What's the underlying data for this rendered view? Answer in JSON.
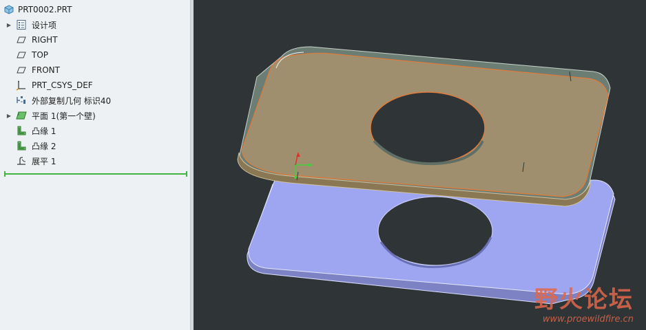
{
  "model_tree": {
    "root": {
      "label": "PRT0002.PRT",
      "icon": "part-icon"
    },
    "items": [
      {
        "label": "设计项",
        "icon": "layer-list-icon",
        "expandable": true
      },
      {
        "label": "RIGHT",
        "icon": "datum-plane-icon",
        "expandable": false
      },
      {
        "label": "TOP",
        "icon": "datum-plane-icon",
        "expandable": false
      },
      {
        "label": "FRONT",
        "icon": "datum-plane-icon",
        "expandable": false
      },
      {
        "label": "PRT_CSYS_DEF",
        "icon": "csys-icon",
        "expandable": false
      },
      {
        "label": "外部复制几何 标识40",
        "icon": "copy-geometry-icon",
        "expandable": false
      },
      {
        "label": "平面 1(第一个壁)",
        "icon": "planar-wall-icon",
        "expandable": true
      },
      {
        "label": "凸缘 1",
        "icon": "flange-icon",
        "expandable": false
      },
      {
        "label": "凸缘 2",
        "icon": "flange-icon",
        "expandable": false
      },
      {
        "label": "展平 1",
        "icon": "unbend-icon",
        "expandable": false
      }
    ]
  },
  "watermark": {
    "brand": "野火论坛",
    "url": "www.proewildfire.cn"
  },
  "colors": {
    "tree_bg": "#eef1f3",
    "viewport_bg": "#2f3537",
    "sheet_top": "#a08f6e",
    "flat_part": "#9ea6f2",
    "insert_line": "#3fb53f"
  }
}
